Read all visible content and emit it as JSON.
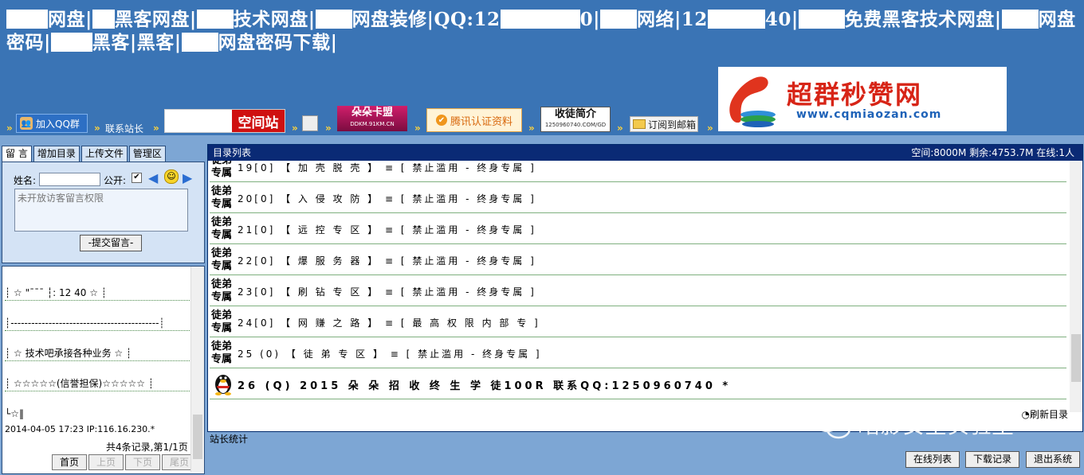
{
  "header": {
    "segments": [
      {
        "mask": 52,
        "text": "网盘|"
      },
      {
        "mask": 28,
        "text": "黑客网盘|"
      },
      {
        "mask": 46,
        "text": "技术网盘|"
      },
      {
        "mask": 46,
        "text": "网盘装修|QQ:12"
      },
      {
        "mask": 100,
        "text": "0|"
      },
      {
        "mask": 46,
        "text": "网络|12"
      },
      {
        "mask": 72,
        "text": "40|"
      },
      {
        "mask": 58,
        "text": "免费黑客技术网盘|"
      },
      {
        "mask": 46,
        "text": "网"
      },
      {
        "mask": 0,
        "text": "盘密码|"
      },
      {
        "mask": 52,
        "text": "黑客|黑客|"
      },
      {
        "mask": 46,
        "text": "网盘密码下载|"
      }
    ]
  },
  "links": {
    "join_qq": "加入QQ群",
    "contact": "联系站长",
    "banner_space": "空间站",
    "banner_card_title": "朵朵卡盟",
    "banner_card_url": "DDKM.91KM.CN",
    "tencent": "腾讯认证资料",
    "intro_title": "收徒简介",
    "intro_sub": "1250960740.COM/GD",
    "subscribe": "订阅到邮箱"
  },
  "ad": {
    "title": "超群秒赞网",
    "url": "www.cqmiaozan.com"
  },
  "left": {
    "tabs": [
      "留 言",
      "增加目录",
      "上传文件",
      "管理区"
    ],
    "name_label": "姓名:",
    "public_label": "公开:",
    "public_checked": "✔",
    "textarea_text": "未开放访客留言权限",
    "submit": "-提交留言-",
    "board_lines": [
      "┊ ☆ \"¯¯¯ ┆: 12 40 ☆ ┊",
      "┊-------------------------------------------┊",
      "┊ ☆ 技术吧承接各种业务 ☆ ┊",
      "┊ ☆☆☆☆☆(信誉担保)☆☆☆☆☆ ┊",
      "└☆‖"
    ],
    "meta": "2014-04-05 17:23 IP:116.16.230.*",
    "count": "共4条记录,第1/1页",
    "pager": [
      "首页",
      "上页",
      "下页",
      "尾页"
    ]
  },
  "right": {
    "title": "目录列表",
    "status": "空间:8000M 剩余:4753.7M 在线:1人",
    "rows": [
      {
        "badge": "徒弟专属",
        "text": "19[0] 【 加 壳 脱 壳 】 ≡ [ 禁止滥用 - 终身专属 ]"
      },
      {
        "badge": "徒弟专属",
        "text": "20[0] 【 入 侵 攻 防 】 ≡ [ 禁止滥用 - 终身专属 ]"
      },
      {
        "badge": "徒弟专属",
        "text": "21[0] 【 远 控 专 区 】 ≡ [ 禁止滥用 - 终身专属 ]"
      },
      {
        "badge": "徒弟专属",
        "text": "22[0] 【 爆 服 务 器 】 ≡ [ 禁止滥用 - 终身专属 ]"
      },
      {
        "badge": "徒弟专属",
        "text": "23[0] 【 刷 钻 专 区 】 ≡ [ 禁止滥用 - 终身专属 ]"
      },
      {
        "badge": "徒弟专属",
        "text": "24[0] 【 网 赚 之 路 】 ≡ [ 最 高 权 限 内 部 专 ]"
      },
      {
        "badge": "徒弟专属",
        "text": "25 (0) 【 徒 弟 专 区 】 ≡ [ 禁止滥用 - 终身专属 ]"
      },
      {
        "badge": "",
        "text": "26 (Q) 2015 朵 朵 招 收 终 生 学 徒100R 联系QQ:1250960740 *"
      }
    ],
    "refresh": "刷新目录"
  },
  "stats": "站长统计",
  "buttons": [
    "在线列表",
    "下载记录",
    "退出系统"
  ],
  "watermark": "暗影安全实验室"
}
